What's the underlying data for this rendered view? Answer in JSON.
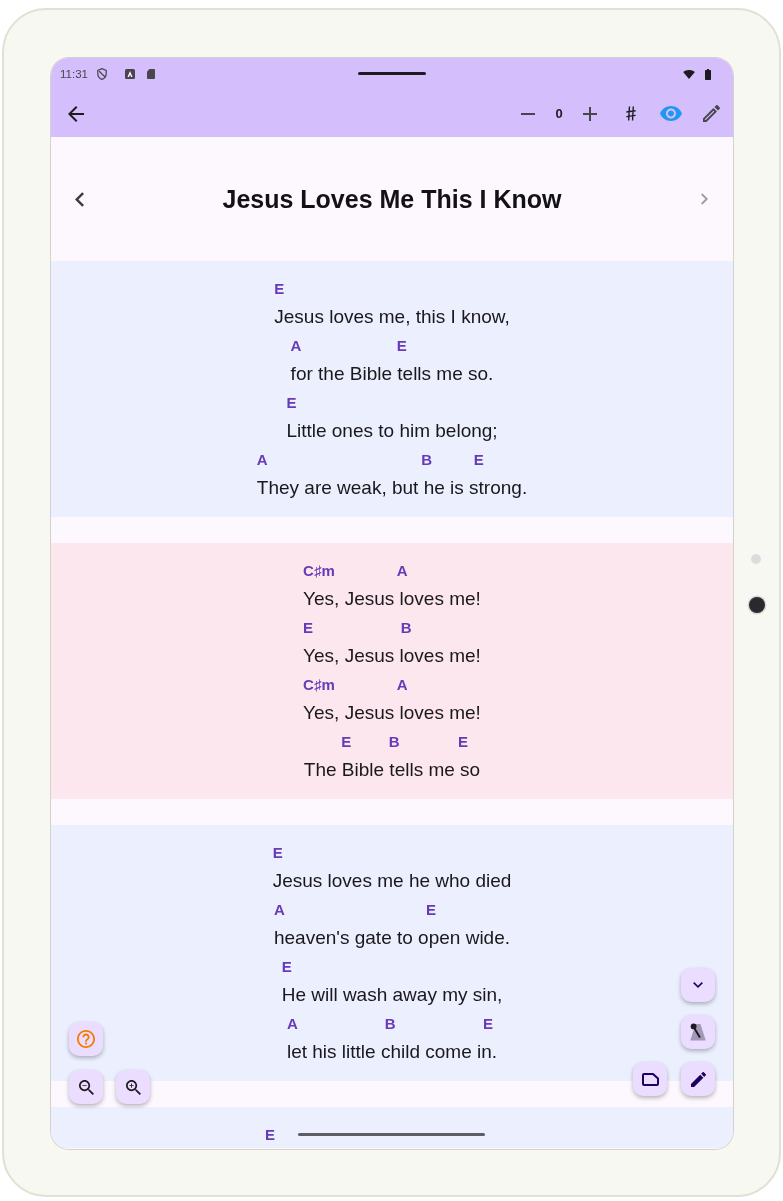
{
  "status_bar": {
    "time": "11:31"
  },
  "toolbar": {
    "transpose_value": "0",
    "show_chords": {
      "on": true
    }
  },
  "song_header": {
    "previous_button": {
      "disabled": false
    },
    "title": "Jesus Loves Me This I Know",
    "next_button": {
      "disabled": true
    }
  },
  "sections": [
    {
      "kind": "verse",
      "lines": [
        {
          "chords": "E",
          "lyric": "Jesus loves me, this I know,"
        },
        {
          "chords": "A                       E",
          "lyric": "for the Bible tells me so."
        },
        {
          "chords": "E",
          "lyric": "Little ones to him belong;"
        },
        {
          "chords": "A                                     B          E",
          "lyric": "They are weak, but he is strong."
        }
      ]
    },
    {
      "kind": "chorus",
      "lines": [
        {
          "chords": "C♯m               A",
          "lyric": "Yes, Jesus loves me!"
        },
        {
          "chords": "E                     B",
          "lyric": "Yes, Jesus loves me!"
        },
        {
          "chords": "C♯m               A",
          "lyric": "Yes, Jesus loves me!"
        },
        {
          "chords": "         E         B              E",
          "lyric": "The Bible tells me so"
        }
      ]
    },
    {
      "kind": "verse",
      "lines": [
        {
          "chords": "E",
          "lyric": "Jesus loves me he who died"
        },
        {
          "chords": "A                                  E",
          "lyric": "heaven's gate to open wide."
        },
        {
          "chords": "E",
          "lyric": "He will wash away my sin,"
        },
        {
          "chords": "A                     B                     E",
          "lyric": "let his little child come in."
        }
      ]
    },
    {
      "kind": "verse",
      "lines": [
        {
          "chords": "E"
        }
      ]
    }
  ]
}
